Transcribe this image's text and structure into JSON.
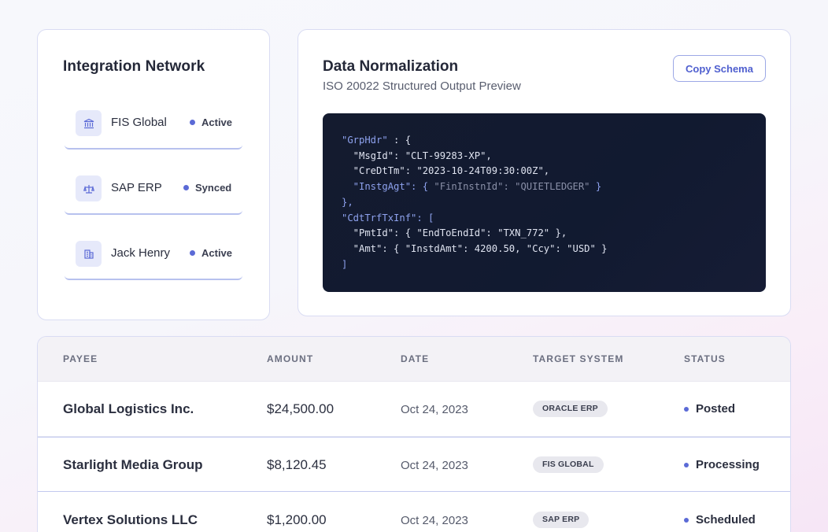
{
  "integration": {
    "title": "Integration Network",
    "items": [
      {
        "name": "FIS Global",
        "status": "Active",
        "icon": "bank-icon"
      },
      {
        "name": "SAP ERP",
        "status": "Synced",
        "icon": "scale-icon"
      },
      {
        "name": "Jack Henry",
        "status": "Active",
        "icon": "building-icon"
      }
    ]
  },
  "normalization": {
    "title": "Data Normalization",
    "subtitle": "ISO 20022 Structured Output Preview",
    "copy_label": "Copy Schema",
    "code": {
      "l1_key": "\"GrpHdr\"",
      "l1_rest": " : {",
      "l2": "  \"MsgId\": \"CLT-99283-XP\",",
      "l3": "  \"CreDtTm\": \"2023-10-24T09:30:00Z\",",
      "l4_key": "  \"InstgAgt\": { ",
      "l4_muted": "\"FinInstnId\": \"QUIETLEDGER\"",
      "l4_end": " }",
      "l5": "},",
      "l6_key": "\"CdtTrfTxInf\": [",
      "l7": "  \"PmtId\": { \"EndToEndId\": \"TXN_772\" },",
      "l8": "  \"Amt\": { \"InstdAmt\": 4200.50, \"Ccy\": \"USD\" }",
      "l9": "]"
    }
  },
  "table": {
    "headers": {
      "payee": "PAYEE",
      "amount": "AMOUNT",
      "date": "DATE",
      "target": "TARGET SYSTEM",
      "status": "STATUS"
    },
    "rows": [
      {
        "payee": "Global Logistics Inc.",
        "amount": "$24,500.00",
        "date": "Oct 24, 2023",
        "target": "ORACLE ERP",
        "status": "Posted"
      },
      {
        "payee": "Starlight Media Group",
        "amount": "$8,120.45",
        "date": "Oct 24, 2023",
        "target": "FIS GLOBAL",
        "status": "Processing"
      },
      {
        "payee": "Vertex Solutions LLC",
        "amount": "$1,200.00",
        "date": "Oct 24, 2023",
        "target": "SAP ERP",
        "status": "Scheduled"
      }
    ]
  },
  "colors": {
    "accent": "#5b6ad6",
    "code_bg": "#141b2f",
    "card_border": "#d9dcf3"
  }
}
